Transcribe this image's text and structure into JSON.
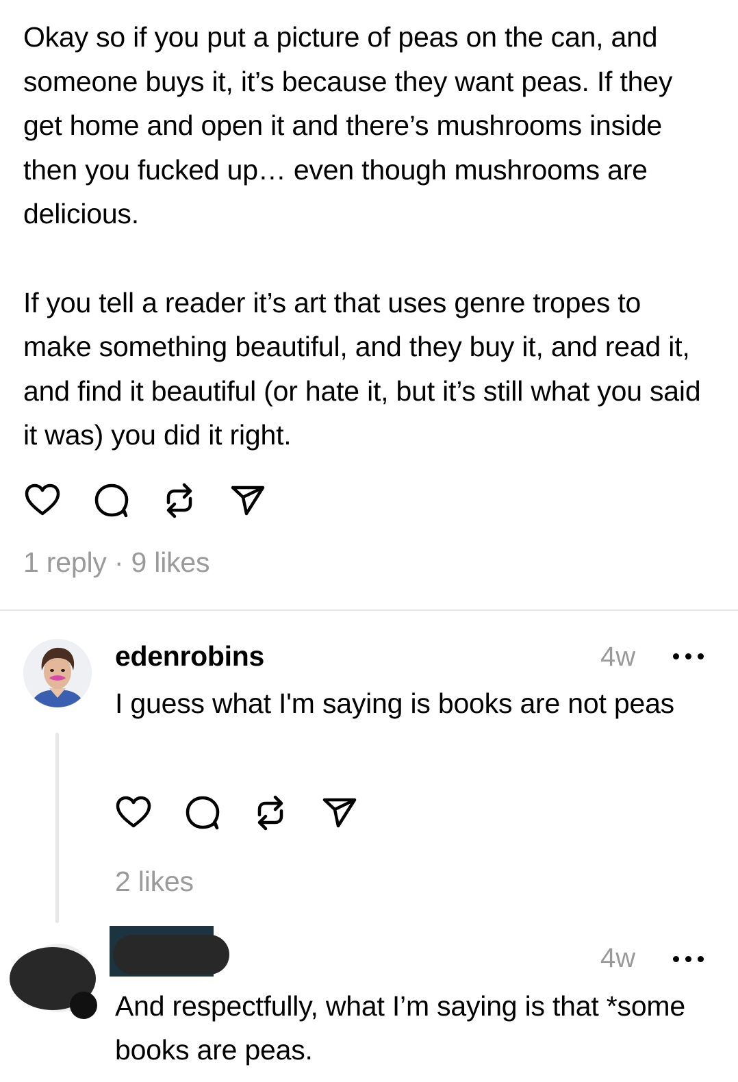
{
  "post": {
    "paragraphs": [
      "Okay so if you put a picture of peas on the can, and someone buys it, it’s because they want peas. If they get home and open it and there’s mushrooms inside then you fucked up… even though mushrooms are delicious.",
      "If you tell a reader it’s art that uses genre tropes to make something beautiful, and they buy it, and read it, and find it beautiful (or hate it, but it’s still what you said it was) you did it right."
    ],
    "stats": "1 reply · 9 likes"
  },
  "replies": [
    {
      "username": "edenrobins",
      "time": "4w",
      "text": "I guess what I'm saying is books are not peas",
      "stats": "2 likes"
    },
    {
      "username": "",
      "time": "4w",
      "text": "And respectfully, what I’m saying is that *some books are peas."
    }
  ],
  "icons": [
    "heart-icon",
    "comment-icon",
    "repost-icon",
    "share-icon",
    "more-icon"
  ],
  "colors": {
    "text": "#000000",
    "muted": "#9a9a9a",
    "divider": "#e6e6e6",
    "redaction": "#282828"
  }
}
